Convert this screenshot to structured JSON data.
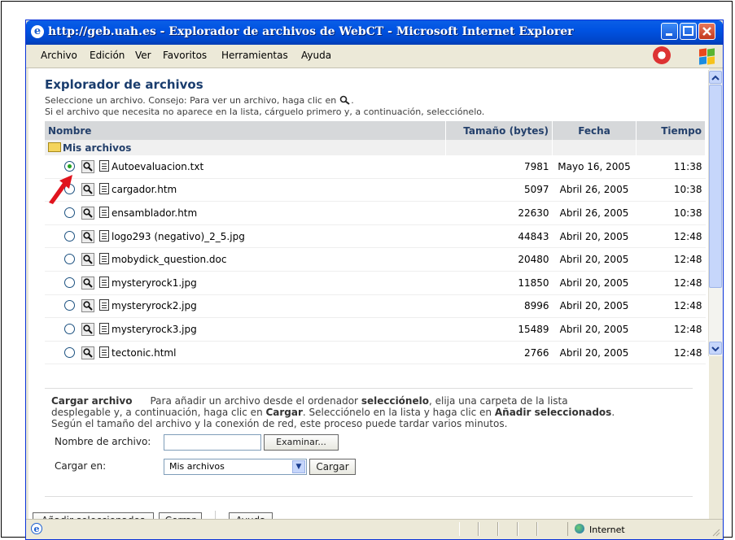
{
  "window": {
    "title": "http://geb.uah.es - Explorador de archivos de WebCT - Microsoft Internet Explorer",
    "minimize_label": "_",
    "maximize_label": "□",
    "close_label": "X"
  },
  "menu": [
    {
      "label": "Archivo"
    },
    {
      "label": "Edición"
    },
    {
      "label": "Ver"
    },
    {
      "label": "Favoritos"
    },
    {
      "label": "Herramientas"
    },
    {
      "label": "Ayuda"
    }
  ],
  "page": {
    "title": "Explorador de archivos",
    "hint1": "Seleccione un archivo. Consejo: Para ver un archivo, haga clic en",
    "hint2": "Si el archivo que necesita no aparece en la lista, cárguelo primero y, a continuación, selecciónelo."
  },
  "table": {
    "headers": {
      "name": "Nombre",
      "size": "Tamaño (bytes)",
      "date": "Fecha",
      "time": "Tiempo"
    },
    "folder": "Mis archivos",
    "rows": [
      {
        "name": "Autoevaluacion.txt",
        "size": "7981",
        "date": "Mayo 16, 2005",
        "time": "11:38",
        "selected": true
      },
      {
        "name": "cargador.htm",
        "size": "5097",
        "date": "Abril 26, 2005",
        "time": "10:38",
        "selected": false
      },
      {
        "name": "ensamblador.htm",
        "size": "22630",
        "date": "Abril 26, 2005",
        "time": "10:38",
        "selected": false
      },
      {
        "name": "logo293 (negativo)_2_5.jpg",
        "size": "44843",
        "date": "Abril 20, 2005",
        "time": "12:48",
        "selected": false
      },
      {
        "name": "mobydick_question.doc",
        "size": "20480",
        "date": "Abril 20, 2005",
        "time": "12:48",
        "selected": false
      },
      {
        "name": "mysteryrock1.jpg",
        "size": "11850",
        "date": "Abril 20, 2005",
        "time": "12:48",
        "selected": false
      },
      {
        "name": "mysteryrock2.jpg",
        "size": "8996",
        "date": "Abril 20, 2005",
        "time": "12:48",
        "selected": false
      },
      {
        "name": "mysteryrock3.jpg",
        "size": "15489",
        "date": "Abril 20, 2005",
        "time": "12:48",
        "selected": false
      },
      {
        "name": "tectonic.html",
        "size": "2766",
        "date": "Abril 20, 2005",
        "time": "12:48",
        "selected": false
      }
    ]
  },
  "upload": {
    "title": "Cargar archivo",
    "desc1_a": "Para añadir un archivo desde el ordenador ",
    "desc1_b": "selecciónelo",
    "desc1_c": ", elija una carpeta de la lista",
    "desc2_a": "desplegable y, a continuación, haga clic en ",
    "desc2_b": "Cargar",
    "desc2_c": ". Selecciónelo en la lista y haga clic en ",
    "desc2_d": "Añadir seleccionados",
    "desc2_e": ".",
    "desc3": "Según el tamaño del archivo y la conexión de red, este proceso puede tardar varios minutos.",
    "filename_label": "Nombre de archivo:",
    "filename_value": "",
    "browse_label": "Examinar...",
    "upload_to_label": "Cargar en:",
    "upload_to_value": "Mis archivos",
    "upload_button": "Cargar"
  },
  "actions": {
    "add_selected": "Añadir seleccionados",
    "close": "Cerrar",
    "help": "Ayuda"
  },
  "status": {
    "zone": "Internet"
  },
  "colors": {
    "title_bar": "#0053e2",
    "heading": "#1a3d6e",
    "table_header_bg": "#d6d8da",
    "selected_radio": "#21a121",
    "arrow": "#e0141e"
  }
}
